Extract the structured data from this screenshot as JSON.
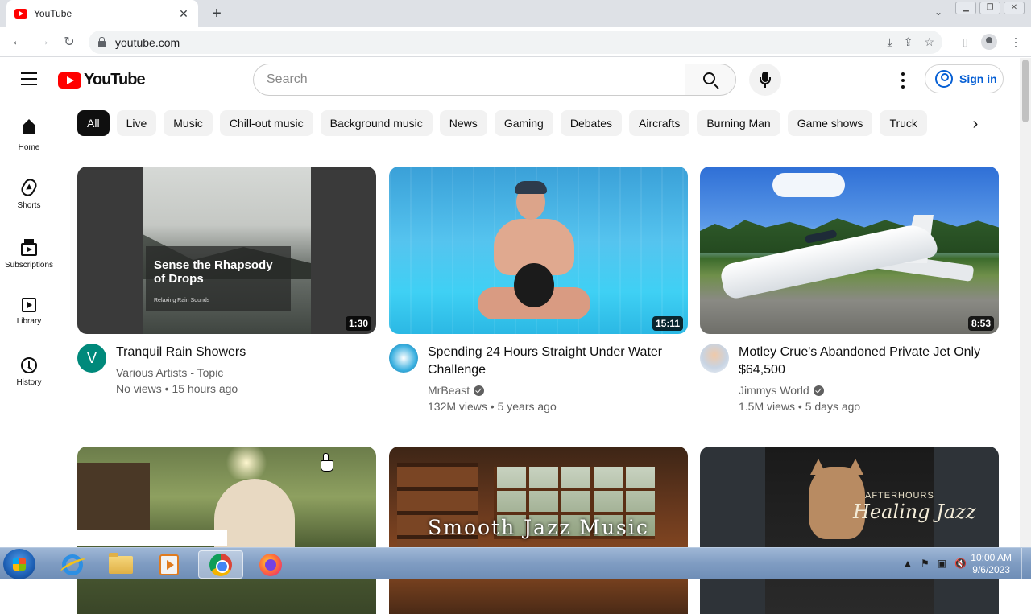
{
  "browser": {
    "tab_title": "YouTube",
    "tab_close": "✕",
    "new_tab": "+",
    "url": "youtube.com"
  },
  "header": {
    "logo_text": "YouTube",
    "search_placeholder": "Search",
    "sign_in": "Sign in"
  },
  "guide": [
    {
      "label": "Home",
      "icon": "home-icon"
    },
    {
      "label": "Shorts",
      "icon": "shorts-icon"
    },
    {
      "label": "Subscriptions",
      "icon": "subscriptions-icon"
    },
    {
      "label": "Library",
      "icon": "library-icon"
    },
    {
      "label": "History",
      "icon": "history-icon"
    }
  ],
  "chips": [
    "All",
    "Live",
    "Music",
    "Chill-out music",
    "Background music",
    "News",
    "Gaming",
    "Debates",
    "Aircrafts",
    "Burning Man",
    "Game shows",
    "Truck"
  ],
  "chip_next": "›",
  "videos": [
    {
      "title": "Tranquil Rain Showers",
      "channel": "Various Artists - Topic",
      "stats": "No views • 15 hours ago",
      "duration": "1:30",
      "avatar_letter": "V",
      "avatar_color": "#00897b",
      "thumb_text": "Sense the Rhapsody of Drops",
      "thumb_sub": "Relaxing Rain Sounds"
    },
    {
      "title": "Spending 24 Hours Straight Under Water Challenge",
      "channel": "MrBeast",
      "stats": "132M views • 5 years ago",
      "duration": "15:11",
      "avatar_color": "#3ab0e0"
    },
    {
      "title": "Motley Crue's Abandoned Private Jet Only $64,500",
      "channel": "Jimmys World",
      "stats": "1.5M views • 5 days ago",
      "duration": "8:53",
      "avatar_color": "#c8d4e3"
    },
    {
      "title": "",
      "thumb_text": ""
    },
    {
      "title": "",
      "thumb_text": "Smooth Jazz Music"
    },
    {
      "title": "",
      "thumb_text_1": "AFTERHOURS",
      "thumb_text_2": "Healing Jazz"
    }
  ],
  "taskbar": {
    "time": "10:00 AM",
    "date": "9/6/2023"
  }
}
